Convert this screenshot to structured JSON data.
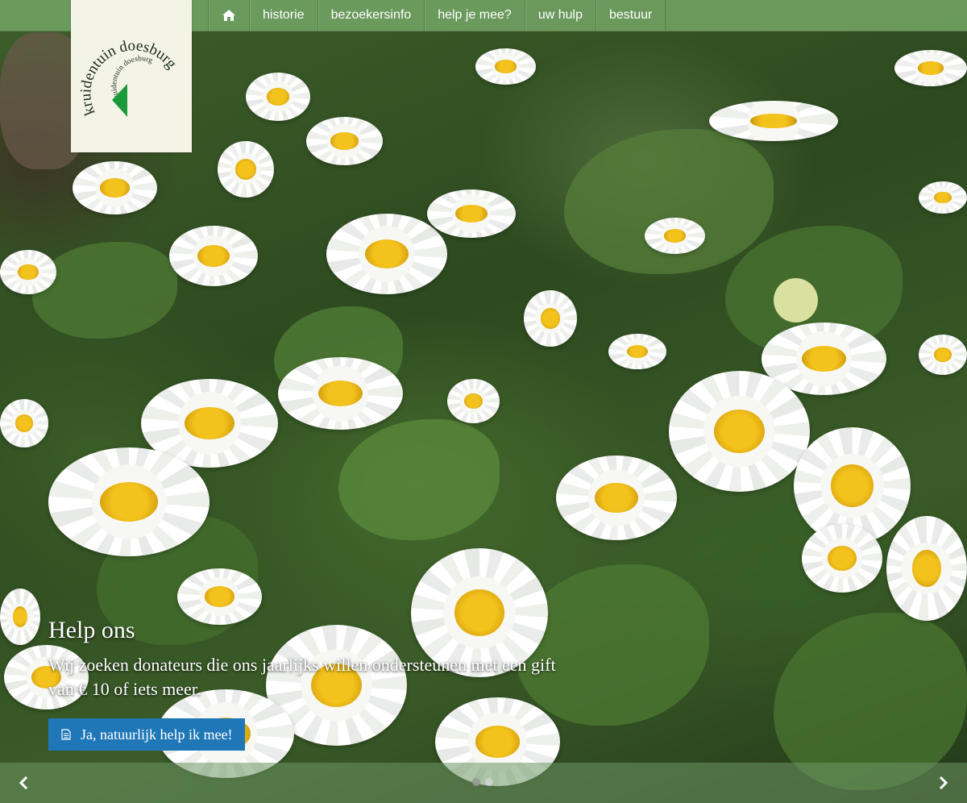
{
  "brand": {
    "logo_alt": "kruidentuin doesburg",
    "logo_outer_text": "kruidentuin doesburg",
    "logo_inner_text": "kruidentuin doesburg",
    "logo_green": "#1a9a3a"
  },
  "nav": {
    "home_icon": "home-icon",
    "items": [
      {
        "label": "historie"
      },
      {
        "label": "bezoekersinfo"
      },
      {
        "label": "help je mee?"
      },
      {
        "label": "uw hulp"
      },
      {
        "label": "bestuur"
      }
    ],
    "background": "#70a062"
  },
  "hero": {
    "title": "Help ons",
    "text": "Wij zoeken donateurs die ons jaarlijks willen ondersteunen met een gift van € 10 of iets meer.",
    "button_label": "Ja, natuurlijk help ik mee!",
    "button_icon": "document-icon",
    "button_color": "#1f77b8"
  },
  "slider": {
    "prev_icon": "chevron-left-icon",
    "next_icon": "chevron-right-icon",
    "slide_count": 2,
    "active_index": 0
  }
}
